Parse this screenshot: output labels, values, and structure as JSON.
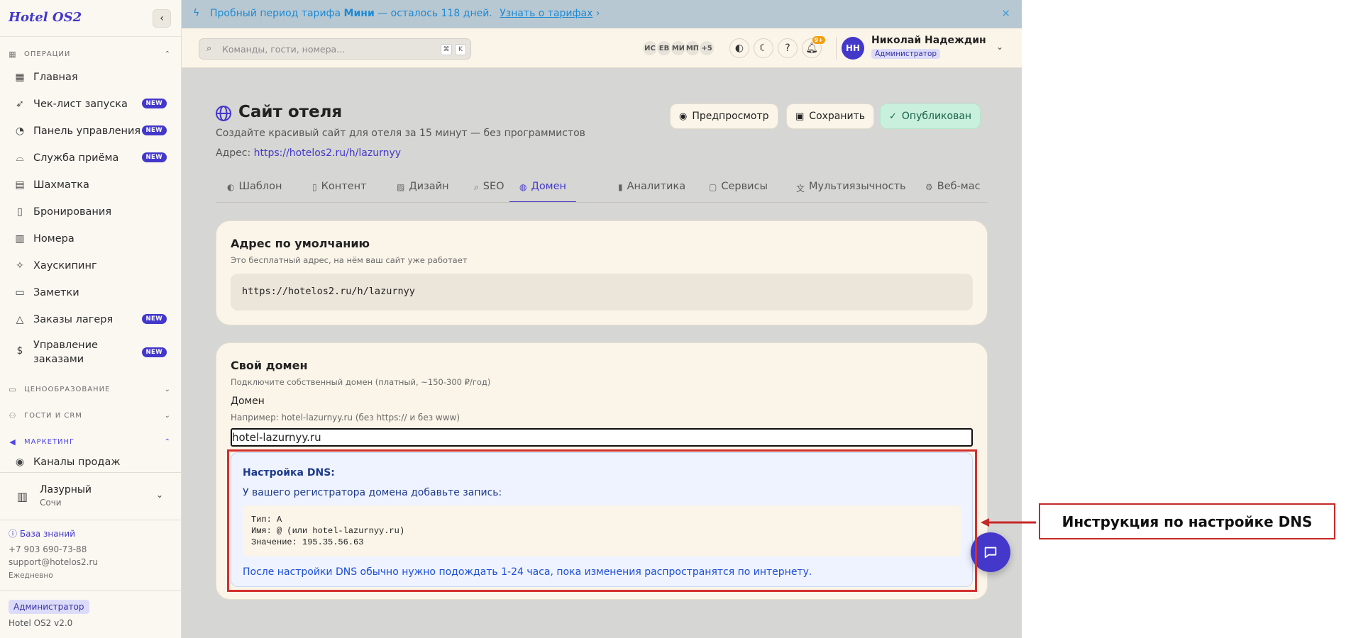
{
  "sidebar": {
    "logo": "Hotel OS2",
    "sections": {
      "operations": "ОПЕРАЦИИ",
      "pricing": "ЦЕНООБРАЗОВАНИЕ",
      "guests": "ГОСТИ И CRM",
      "marketing": "МАРКЕТИНГ"
    },
    "items": [
      {
        "label": "Главная",
        "icon": "dashboard-icon"
      },
      {
        "label": "Чек-лист запуска",
        "icon": "rocket-icon",
        "badge": "NEW"
      },
      {
        "label": "Панель управления",
        "icon": "gauge-icon",
        "badge": "NEW"
      },
      {
        "label": "Служба приёма",
        "icon": "bell-desk-icon",
        "badge": "NEW"
      },
      {
        "label": "Шахматка",
        "icon": "grid-icon"
      },
      {
        "label": "Бронирования",
        "icon": "clipboard-icon"
      },
      {
        "label": "Номера",
        "icon": "building-icon"
      },
      {
        "label": "Хаускипинг",
        "icon": "sparkles-icon"
      },
      {
        "label": "Заметки",
        "icon": "note-icon"
      },
      {
        "label": "Заказы лагеря",
        "icon": "tent-icon",
        "badge": "NEW"
      },
      {
        "label": "Управление заказами",
        "icon": "dollar-icon",
        "badge": "NEW"
      }
    ],
    "marketing_items": [
      {
        "label": "Каналы продаж",
        "icon": "radio-icon"
      }
    ],
    "hotel": {
      "name": "Лазурный",
      "city": "Сочи"
    },
    "footer": {
      "kb": "База знаний",
      "phone": "+7 903 690-73-88",
      "email": "support@hotelos2.ru",
      "hours": "Ежедневно",
      "role": "Администратор",
      "version": "Hotel OS2 v2.0"
    }
  },
  "banner": {
    "pre": "Пробный период тарифа",
    "plan": "Мини",
    "post": "— осталось 118 дней.",
    "link": "Узнать о тарифах"
  },
  "topbar": {
    "search_placeholder": "Команды, гости, номера...",
    "kbd1": "⌘",
    "kbd2": "K",
    "avatars": [
      "ИС",
      "ЕВ",
      "МИ",
      "МП",
      "+5"
    ],
    "notif_count": "9+",
    "user_initials": "НН",
    "user_name": "Николай Надеждин",
    "user_role": "Администратор"
  },
  "page": {
    "title": "Сайт отеля",
    "subtitle": "Создайте красивый сайт для отеля за 15 минут — без программистов",
    "address_label": "Адрес:",
    "address_url": "https://hotelos2.ru/h/lazurnyy",
    "buttons": {
      "preview": "Предпросмотр",
      "save": "Сохранить",
      "published": "Опубликован"
    },
    "tabs": [
      "Шаблон",
      "Контент",
      "Дизайн",
      "SEO",
      "Домен",
      "Аналитика",
      "Сервисы",
      "Мультиязычность",
      "Веб-мас"
    ],
    "active_tab": "Домен"
  },
  "default_card": {
    "title": "Адрес по умолчанию",
    "subtitle": "Это бесплатный адрес, на нём ваш сайт уже работает",
    "url": "https://hotelos2.ru/h/lazurnyy"
  },
  "custom_card": {
    "title": "Свой домен",
    "subtitle": "Подключите собственный домен (платный, ~150-300 ₽/год)",
    "field_label": "Домен",
    "field_hint": "Например: hotel-lazurnyy.ru (без https:// и без www)",
    "field_value": "hotel-lazurnyy.ru",
    "dns": {
      "title": "Настройка DNS:",
      "desc": "У вашего регистратора домена добавьте запись:",
      "line1": "Тип: A",
      "line2": "Имя: @ (или hotel-lazurnyy.ru)",
      "line3": "Значение: 195.35.56.63",
      "note": "После настройки DNS обычно нужно подождать 1-24 часа, пока изменения распространятся по интернету."
    }
  },
  "annotation": {
    "label": "Инструкция по настройке DNS",
    "color": "#d32f2f"
  },
  "colors": {
    "accent": "#4338ca",
    "banner_text": "#1d8ad4",
    "published": "#17634a"
  }
}
